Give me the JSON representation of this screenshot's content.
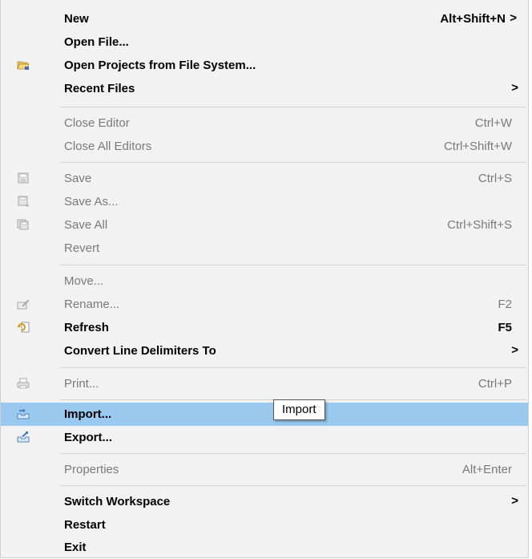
{
  "menu": {
    "items": [
      {
        "label": "New",
        "shortcut": "Alt+Shift+N",
        "submenu": true,
        "enabled": true
      },
      {
        "label": "Open File...",
        "shortcut": "",
        "enabled": true
      },
      {
        "label": "Open Projects from File System...",
        "shortcut": "",
        "enabled": true,
        "icon": "folder-open-icon"
      },
      {
        "label": "Recent Files",
        "shortcut": "",
        "submenu": true,
        "enabled": true
      },
      {
        "label": "Close Editor",
        "shortcut": "Ctrl+W",
        "enabled": false
      },
      {
        "label": "Close All Editors",
        "shortcut": "Ctrl+Shift+W",
        "enabled": false
      },
      {
        "label": "Save",
        "shortcut": "Ctrl+S",
        "enabled": false,
        "icon": "save-icon"
      },
      {
        "label": "Save As...",
        "shortcut": "",
        "enabled": false,
        "icon": "save-as-icon"
      },
      {
        "label": "Save All",
        "shortcut": "Ctrl+Shift+S",
        "enabled": false,
        "icon": "save-all-icon"
      },
      {
        "label": "Revert",
        "shortcut": "",
        "enabled": false
      },
      {
        "label": "Move...",
        "shortcut": "",
        "enabled": false
      },
      {
        "label": "Rename...",
        "shortcut": "F2",
        "enabled": false,
        "icon": "rename-icon"
      },
      {
        "label": "Refresh",
        "shortcut": "F5",
        "enabled": true,
        "icon": "refresh-icon"
      },
      {
        "label": "Convert Line Delimiters To",
        "shortcut": "",
        "submenu": true,
        "enabled": true
      },
      {
        "label": "Print...",
        "shortcut": "Ctrl+P",
        "enabled": false,
        "icon": "print-icon"
      },
      {
        "label": "Import...",
        "shortcut": "",
        "enabled": true,
        "highlighted": true,
        "icon": "import-icon"
      },
      {
        "label": "Export...",
        "shortcut": "",
        "enabled": true,
        "icon": "export-icon"
      },
      {
        "label": "Properties",
        "shortcut": "Alt+Enter",
        "enabled": false
      },
      {
        "label": "Switch Workspace",
        "shortcut": "",
        "submenu": true,
        "enabled": true
      },
      {
        "label": "Restart",
        "shortcut": "",
        "enabled": true
      },
      {
        "label": "Exit",
        "shortcut": "",
        "enabled": true
      }
    ],
    "submenu_arrow": ">"
  },
  "tooltip": {
    "text": "Import"
  },
  "colors": {
    "menu_bg": "#f2f2f2",
    "highlight": "#99c9ef",
    "disabled_text": "#7a7a7a",
    "separator": "#d4d4d4"
  }
}
